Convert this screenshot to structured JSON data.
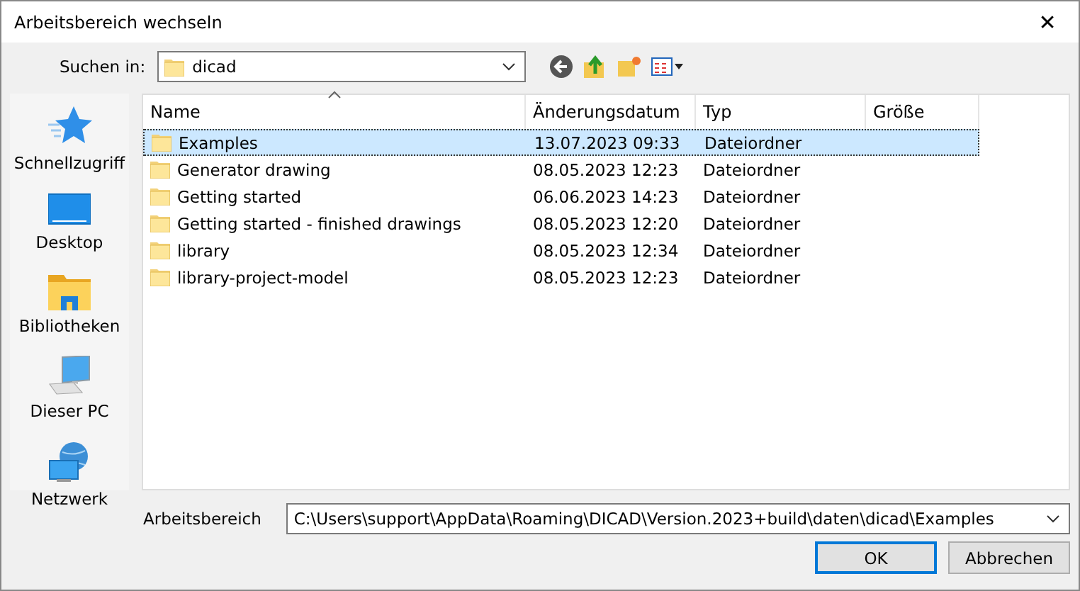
{
  "window": {
    "title": "Arbeitsbereich wechseln",
    "close": "✕"
  },
  "look_in": {
    "label": "Suchen in:",
    "value": "dicad"
  },
  "places": [
    {
      "label": "Schnellzugriff",
      "kind": "star"
    },
    {
      "label": "Desktop",
      "kind": "desktop"
    },
    {
      "label": "Bibliotheken",
      "kind": "library"
    },
    {
      "label": "Dieser PC",
      "kind": "pc"
    },
    {
      "label": "Netzwerk",
      "kind": "network"
    }
  ],
  "table": {
    "columns": [
      "Name",
      "Änderungsdatum",
      "Typ",
      "Größe"
    ],
    "rows": [
      {
        "name": "Examples",
        "date": "13.07.2023 09:33",
        "type": "Dateiordner",
        "selected": true
      },
      {
        "name": "Generator drawing",
        "date": "08.05.2023 12:23",
        "type": "Dateiordner",
        "selected": false
      },
      {
        "name": "Getting started",
        "date": "06.06.2023 14:23",
        "type": "Dateiordner",
        "selected": false
      },
      {
        "name": "Getting started - finished drawings",
        "date": "08.05.2023 12:20",
        "type": "Dateiordner",
        "selected": false
      },
      {
        "name": "library",
        "date": "08.05.2023 12:34",
        "type": "Dateiordner",
        "selected": false
      },
      {
        "name": "library-project-model",
        "date": "08.05.2023 12:23",
        "type": "Dateiordner",
        "selected": false
      }
    ]
  },
  "workspace": {
    "label": "Arbeitsbereich",
    "value": "C:\\Users\\support\\AppData\\Roaming\\DICAD\\Version.2023+build\\daten\\dicad\\Examples"
  },
  "buttons": [
    "OK",
    "Abbrechen"
  ]
}
